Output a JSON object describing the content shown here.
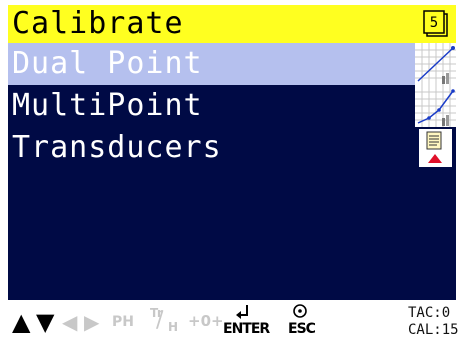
{
  "header": {
    "title": "Calibrate",
    "badge_number": "5"
  },
  "menu": {
    "items": [
      {
        "label": "Dual Point",
        "icon": "dual-point-graph-icon",
        "selected": true
      },
      {
        "label": "MultiPoint",
        "icon": "multipoint-graph-icon",
        "selected": false
      },
      {
        "label": "Transducers",
        "icon": "transducer-document-icon",
        "selected": false
      }
    ]
  },
  "statusbar": {
    "up": "▲",
    "down": "▼",
    "left": "◀",
    "right": "▶",
    "ph": "PH",
    "tr": "Tr",
    "h": "H",
    "zero": "+0+",
    "enter_label": "ENTER",
    "esc_label": "ESC",
    "tac": "TAC:0",
    "cal": "CAL:15"
  },
  "colors": {
    "lcd_background": "#000a45",
    "title_bar": "#ffff20",
    "selection": "#b5c0ee",
    "disabled": "#c8c8c8"
  }
}
